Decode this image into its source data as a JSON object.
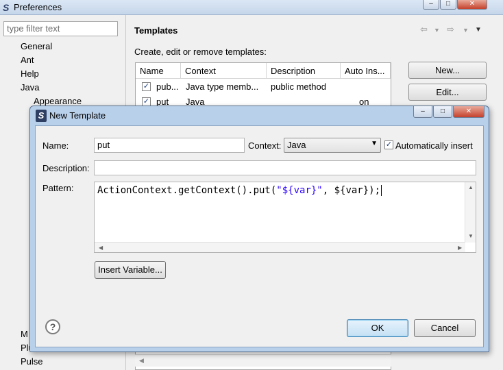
{
  "preferences": {
    "title": "Preferences",
    "filter_placeholder": "type filter text",
    "tree": [
      "General",
      "Ant",
      "Help",
      "Java",
      "Appearance"
    ],
    "tree_bottom": [
      "M",
      "Plu",
      "Pulse"
    ],
    "page_title": "Templates",
    "description": "Create, edit or remove templates:",
    "columns": [
      "Name",
      "Context",
      "Description",
      "Auto Ins..."
    ],
    "rows": [
      {
        "name": "pub...",
        "context": "Java type memb...",
        "description": "public method",
        "auto": ""
      },
      {
        "name": "put",
        "context": "Java",
        "description": "",
        "auto": "on"
      }
    ],
    "buttons": {
      "new": "New...",
      "edit": "Edit..."
    }
  },
  "dialog": {
    "title": "New Template",
    "name_label": "Name:",
    "name_value": "put",
    "context_label": "Context:",
    "context_value": "Java",
    "auto_insert_label": "Automatically insert",
    "description_label": "Description:",
    "description_value": "",
    "pattern_label": "Pattern:",
    "pattern": {
      "prefix": "ActionContext.getContext().put(",
      "string_literal": "\"${var}\"",
      "suffix": ", ${var});"
    },
    "insert_variable": "Insert Variable...",
    "ok": "OK",
    "cancel": "Cancel",
    "help": "?"
  }
}
